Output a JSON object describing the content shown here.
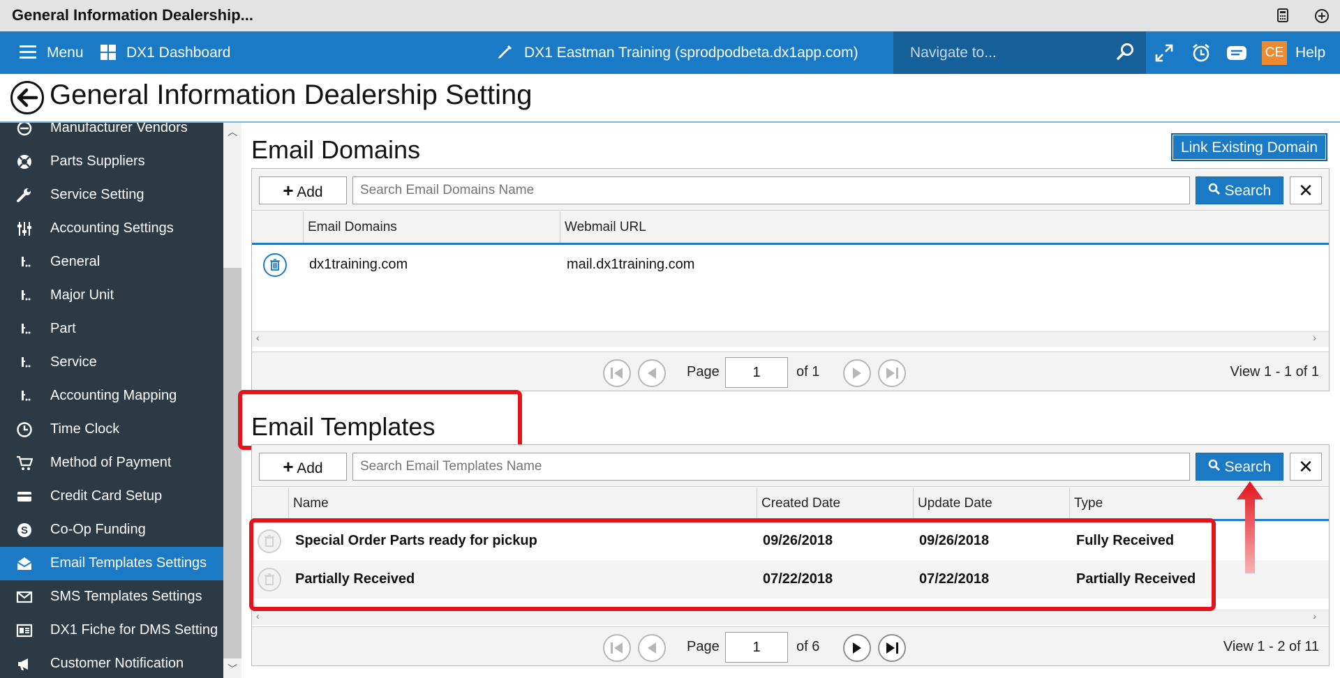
{
  "window": {
    "title": "General Information Dealership..."
  },
  "topnav": {
    "menu_label": "Menu",
    "dashboard_label": "DX1 Dashboard",
    "environment": "DX1 Eastman Training (sprodpodbeta.dx1app.com)",
    "search_placeholder": "Navigate to...",
    "user_initials": "CE",
    "help_label": "Help"
  },
  "page": {
    "title": "General Information Dealership Setting"
  },
  "sidebar": {
    "items": [
      {
        "label": "Manufacturer Vendors",
        "icon": "vendor-icon"
      },
      {
        "label": "Parts Suppliers",
        "icon": "lifebuoy-icon"
      },
      {
        "label": "Service Setting",
        "icon": "wrench-icon"
      },
      {
        "label": "Accounting Settings",
        "icon": "sliders-icon"
      },
      {
        "label": "General",
        "icon": "sub-item-icon"
      },
      {
        "label": "Major Unit",
        "icon": "sub-item-icon"
      },
      {
        "label": "Part",
        "icon": "sub-item-icon"
      },
      {
        "label": "Service",
        "icon": "sub-item-icon"
      },
      {
        "label": "Accounting Mapping",
        "icon": "sub-item-icon"
      },
      {
        "label": "Time Clock",
        "icon": "clock-icon"
      },
      {
        "label": "Method of Payment",
        "icon": "cart-icon"
      },
      {
        "label": "Credit Card Setup",
        "icon": "credit-card-icon"
      },
      {
        "label": "Co-Op Funding",
        "icon": "dollar-icon"
      },
      {
        "label": "Email Templates Settings",
        "icon": "email-open-icon",
        "active": true
      },
      {
        "label": "SMS Templates Settings",
        "icon": "envelope-icon"
      },
      {
        "label": "DX1 Fiche for DMS Setting",
        "icon": "fiche-icon"
      },
      {
        "label": "Customer Notification",
        "icon": "megaphone-icon"
      }
    ]
  },
  "email_domains": {
    "title": "Email Domains",
    "link_button": "Link Existing Domain",
    "add_label": "Add",
    "search_placeholder": "Search Email Domains Name",
    "search_label": "Search",
    "clear_label": "✕",
    "columns": [
      "Email Domains",
      "Webmail URL"
    ],
    "rows": [
      {
        "domain": "dx1training.com",
        "webmail": "mail.dx1training.com"
      }
    ],
    "pager": {
      "page_label": "Page",
      "page": "1",
      "of_label": "of 1",
      "view": "View 1 - 1 of 1"
    }
  },
  "email_templates": {
    "title": "Email Templates",
    "add_label": "Add",
    "search_placeholder": "Search Email Templates Name",
    "search_label": "Search",
    "clear_label": "✕",
    "columns": [
      "Name",
      "Created Date",
      "Update Date",
      "Type"
    ],
    "rows": [
      {
        "name": "Special Order Parts ready for pickup",
        "created": "09/26/2018",
        "updated": "09/26/2018",
        "type": "Fully Received"
      },
      {
        "name": "Partially Received",
        "created": "07/22/2018",
        "updated": "07/22/2018",
        "type": "Partially Received"
      }
    ],
    "pager": {
      "page_label": "Page",
      "page": "1",
      "of_label": "of 6",
      "view": "View 1 - 2 of 11"
    }
  },
  "colors": {
    "primary": "#1a7ac6",
    "sidebar": "#2b3a45",
    "highlight": "#e3141b",
    "accent_badge": "#f08a2e"
  }
}
